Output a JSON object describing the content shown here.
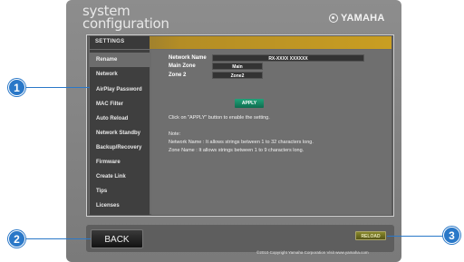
{
  "header": {
    "title_line1": "system",
    "title_line2": "configuration",
    "brand": "YAMAHA",
    "brand_icon": "yamaha-tuning-fork-icon"
  },
  "panel": {
    "tab_label": "SETTINGS"
  },
  "sidebar": {
    "items": [
      {
        "label": "Rename",
        "active": true
      },
      {
        "label": "Network"
      },
      {
        "label": "AirPlay Password"
      },
      {
        "label": "MAC Filter"
      },
      {
        "label": "Auto Reload"
      },
      {
        "label": "Network Standby"
      },
      {
        "label": "Backup/Recovery"
      },
      {
        "label": "Firmware"
      },
      {
        "label": "Create Link"
      },
      {
        "label": "Tips"
      },
      {
        "label": "Licenses"
      }
    ]
  },
  "form": {
    "network_name_label": "Network Name",
    "network_name_value": "RX-XXXX XXXXXX",
    "main_zone_label": "Main Zone",
    "main_zone_value": "Main",
    "zone2_label": "Zone 2",
    "zone2_value": "Zone2",
    "apply_label": "APPLY",
    "instruction": "Click on \"APPLY\" button to enable the setting.",
    "note_title": "Note:",
    "note_line1": "Network Name : It allows strings between 1 to 32 characters long.",
    "note_line2": "Zone Name : It allows strings between 1 to 9 characters long."
  },
  "footer": {
    "back_label": "BACK",
    "reload_label": "RELOAD",
    "copyright": "©2010 Copyright Yamaha Corporation Visit  www.yamaha.com"
  },
  "callouts": [
    "1",
    "2",
    "3"
  ],
  "colors": {
    "accent": "#c99e22",
    "callout": "#2a78c8",
    "apply": "#1a8a65"
  }
}
